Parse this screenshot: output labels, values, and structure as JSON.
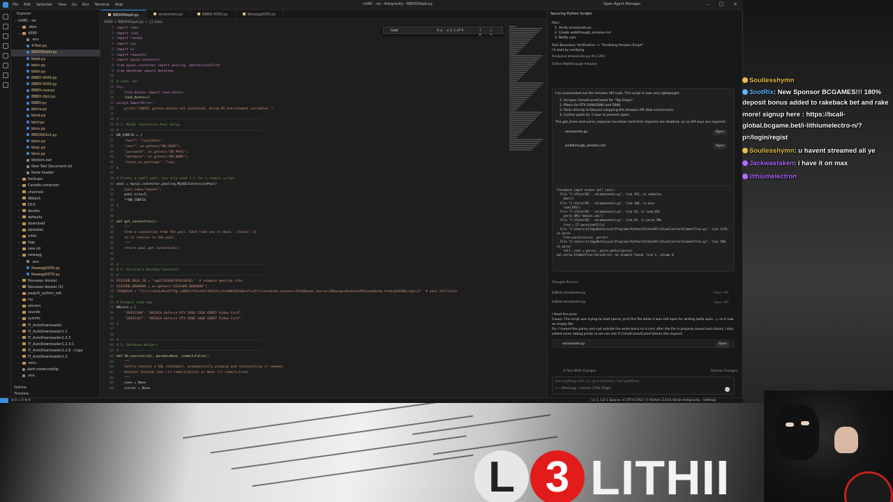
{
  "window": {
    "menu": [
      "File",
      "Edit",
      "Selection",
      "View",
      "Go",
      "Run",
      "Terminal",
      "Help"
    ],
    "title": "milRC - ne - Antigravity - BB5000opti.py",
    "agent_manager": "Open Agent Manager"
  },
  "explorer": {
    "header": "Explorer",
    "root": "milRC - ne",
    "items": [
      {
        "name": ".idea",
        "type": "folder",
        "indent": 1
      },
      {
        "name": "4090",
        "type": "folder",
        "indent": 1,
        "open": true
      },
      {
        "name": ".env",
        "type": "file",
        "indent": 2
      },
      {
        "name": "4-Test.py",
        "type": "py",
        "indent": 2
      },
      {
        "name": "BB5000opti.py",
        "type": "py",
        "indent": 2,
        "selected": true
      },
      {
        "name": "bbeb.py",
        "type": "py",
        "indent": 2
      },
      {
        "name": "bbbc.py",
        "type": "py",
        "indent": 2
      },
      {
        "name": "bbbo.py",
        "type": "py",
        "indent": 2
      },
      {
        "name": "BBBO-4000.py",
        "type": "py",
        "indent": 2
      },
      {
        "name": "BBBO-5000.py",
        "type": "py",
        "indent": 2
      },
      {
        "name": "BBBO-new.py",
        "type": "py",
        "indent": 2
      },
      {
        "name": "BBBO-Opti.py",
        "type": "py",
        "indent": 2
      },
      {
        "name": "BBBO.py",
        "type": "py",
        "indent": 2
      },
      {
        "name": "bbma.py",
        "type": "py",
        "indent": 2
      },
      {
        "name": "bbnb.py",
        "type": "py",
        "indent": 2
      },
      {
        "name": "bbnf.py",
        "type": "py",
        "indent": 2
      },
      {
        "name": "bbns.py",
        "type": "py",
        "indent": 2
      },
      {
        "name": "BBS0002v2.py",
        "type": "py",
        "indent": 2
      },
      {
        "name": "bbon.py",
        "type": "py",
        "indent": 2
      },
      {
        "name": "bbqc.py",
        "type": "py",
        "indent": 2
      },
      {
        "name": "bbsn.py",
        "type": "py",
        "indent": 2
      },
      {
        "name": "bbstore.bat",
        "type": "file",
        "indent": 2
      },
      {
        "name": "New Text Document.txt",
        "type": "file",
        "indent": 2
      },
      {
        "name": "Node header",
        "type": "file",
        "indent": 2
      },
      {
        "name": "backups",
        "type": "folder",
        "indent": 1
      },
      {
        "name": "Canada computer",
        "type": "folder",
        "indent": 1
      },
      {
        "name": "channels",
        "type": "folder",
        "indent": 1
      },
      {
        "name": "dbback",
        "type": "folder",
        "indent": 1
      },
      {
        "name": "DCX",
        "type": "folder",
        "indent": 1
      },
      {
        "name": "docdoc",
        "type": "folder",
        "indent": 1
      },
      {
        "name": "defaults",
        "type": "folder",
        "indent": 1
      },
      {
        "name": "download",
        "type": "folder",
        "indent": 1
      },
      {
        "name": "episodes",
        "type": "folder",
        "indent": 1
      },
      {
        "name": "infist",
        "type": "folder",
        "indent": 1
      },
      {
        "name": "logs",
        "type": "folder",
        "indent": 1
      },
      {
        "name": "new cd",
        "type": "folder",
        "indent": 1
      },
      {
        "name": "newegg",
        "type": "folder",
        "indent": 1,
        "open": true
      },
      {
        "name": ".env",
        "type": "file",
        "indent": 2
      },
      {
        "name": "Newegg5000.py",
        "type": "py",
        "indent": 2
      },
      {
        "name": "Newegg5070.py",
        "type": "py",
        "indent": 2
      },
      {
        "name": "Nouveau dossier",
        "type": "folder",
        "indent": 1
      },
      {
        "name": "Nouveau dossier (2)",
        "type": "folder",
        "indent": 1
      },
      {
        "name": "paapi5_python_sdk",
        "type": "folder",
        "indent": 1
      },
      {
        "name": "rss",
        "type": "folder",
        "indent": 1
      },
      {
        "name": "servers",
        "type": "folder",
        "indent": 1
      },
      {
        "name": "sounds",
        "type": "folder",
        "indent": 1
      },
      {
        "name": "sysinfo",
        "type": "folder",
        "indent": 1
      },
      {
        "name": "TI_AutoDownloader",
        "type": "folder",
        "indent": 1
      },
      {
        "name": "TI_AutoDownloader1.1",
        "type": "folder",
        "indent": 1
      },
      {
        "name": "TI_AutoDownloader1.2.3",
        "type": "folder",
        "indent": 1
      },
      {
        "name": "TI_AutoDownloader1.2.3-1",
        "type": "folder",
        "indent": 1
      },
      {
        "name": "TI_AutoDownloader1.2.6 - Copy",
        "type": "folder",
        "indent": 1
      },
      {
        "name": "TI_AutoDownloader1.3",
        "type": "folder",
        "indent": 1
      },
      {
        "name": "venv",
        "type": "folder",
        "indent": 1
      },
      {
        "name": "dark-mode-tooltip",
        "type": "file",
        "indent": 1
      },
      {
        "name": ".env",
        "type": "file",
        "indent": 1
      }
    ],
    "footer": [
      "Outline",
      "Timeline"
    ]
  },
  "editor": {
    "tabs": [
      {
        "label": "BB5000opti.py",
        "active": true
      },
      {
        "label": "amazonele.py",
        "active": false
      },
      {
        "label": "BBBO-5000.py",
        "active": false
      },
      {
        "label": "Newegg5000.py",
        "active": false
      }
    ],
    "breadcrumb": "4090 > BB5000opti.py > {} time",
    "find": {
      "query": "load",
      "options": "Aa ab .*",
      "count": "1 of 4",
      "nav": "↑ ↓ ≡ ×"
    },
    "lines": [
      {
        "n": "1",
        "t": "import time",
        "k": "kw"
      },
      {
        "n": "2",
        "t": "import json",
        "k": "kw"
      },
      {
        "n": "3",
        "t": "import random",
        "k": "kw"
      },
      {
        "n": "4",
        "t": "import sys",
        "k": "kw"
      },
      {
        "n": "5",
        "t": "import os",
        "k": "kw"
      },
      {
        "n": "6",
        "t": "import requests",
        "k": "kw"
      },
      {
        "n": "7",
        "t": "import mysql.connector",
        "k": "kw"
      },
      {
        "n": "8",
        "t": "from mysql.connector import pooling, OperationalError",
        "k": "kw"
      },
      {
        "n": "9",
        "t": "from datetime import datetime",
        "k": "kw"
      },
      {
        "n": "10",
        "t": "",
        "k": ""
      },
      {
        "n": "11",
        "t": "# Load .env",
        "k": "cm"
      },
      {
        "n": "12",
        "t": "try:",
        "k": "kw"
      },
      {
        "n": "13",
        "t": "    from dotenv import load_dotenv",
        "k": "kw"
      },
      {
        "n": "14",
        "t": "    load_dotenv()",
        "k": "fn"
      },
      {
        "n": "15",
        "t": "except ImportError:",
        "k": "kw"
      },
      {
        "n": "16",
        "t": "    print(\"[INFO] python-dotenv not installed. Using OS environment variables.\")",
        "k": "st"
      },
      {
        "n": "17",
        "t": "",
        "k": ""
      },
      {
        "n": "18",
        "t": "# ------------------------------------------------------------------------",
        "k": "cm"
      },
      {
        "n": "19",
        "t": "# 1. MySQL Connection Pool Setup",
        "k": "cm"
      },
      {
        "n": "20",
        "t": "# ------------------------------------------------------------------------",
        "k": "cm"
      },
      {
        "n": "21",
        "t": "DB_CONFIG = {",
        "k": ""
      },
      {
        "n": "22",
        "t": "    \"host\": \"localhost\",",
        "k": "st"
      },
      {
        "n": "23",
        "t": "    \"user\": os.getenv(\"DB_USER\"),",
        "k": "st"
      },
      {
        "n": "24",
        "t": "    \"password\": os.getenv(\"DB_PASS\"),",
        "k": "st"
      },
      {
        "n": "25",
        "t": "    \"database\": os.getenv(\"DB_NAME\"),",
        "k": "st"
      },
      {
        "n": "26",
        "t": "    \"raise_on_warnings\": True,",
        "k": "st"
      },
      {
        "n": "27",
        "t": "}",
        "k": ""
      },
      {
        "n": "28",
        "t": "",
        "k": ""
      },
      {
        "n": "29",
        "t": "# Create a small pool; you only need 1-5 for a simple script",
        "k": "cm"
      },
      {
        "n": "30",
        "t": "pool = mysql.connector.pooling.MySQLConnectionPool(",
        "k": ""
      },
      {
        "n": "31",
        "t": "    pool_name=\"mypool\",",
        "k": "st"
      },
      {
        "n": "32",
        "t": "    pool_size=5,",
        "k": ""
      },
      {
        "n": "33",
        "t": "    **DB_CONFIG",
        "k": ""
      },
      {
        "n": "34",
        "t": ")",
        "k": ""
      },
      {
        "n": "35",
        "t": "",
        "k": ""
      },
      {
        "n": "36",
        "t": "",
        "k": ""
      },
      {
        "n": "37",
        "t": "def get_connection():",
        "k": "fn"
      },
      {
        "n": "38",
        "t": "    \"\"\"",
        "k": "st"
      },
      {
        "n": "39",
        "t": "    Grab a connection from the pool. Each time you're done, .close() it",
        "k": "st"
      },
      {
        "n": "40",
        "t": "    so it returns to the pool.",
        "k": "st"
      },
      {
        "n": "41",
        "t": "    \"\"\"",
        "k": "st"
      },
      {
        "n": "42",
        "t": "    return pool.get_connection()",
        "k": "kw"
      },
      {
        "n": "43",
        "t": "",
        "k": ""
      },
      {
        "n": "44",
        "t": "",
        "k": ""
      },
      {
        "n": "45",
        "t": "# ------------------------------------------------------------------------",
        "k": "cm"
      },
      {
        "n": "46",
        "t": "# 2. Discord & BestBuy Constants",
        "k": "cm"
      },
      {
        "n": "47",
        "t": "# ------------------------------------------------------------------------",
        "k": "cm"
      },
      {
        "n": "48",
        "t": "DISCORD_ROLE_ID = \"<@&1745048295919636>\"  # example mention role",
        "k": "st"
      },
      {
        "n": "49",
        "t": "DISCORD_WEBHOOK = os.getenv(\"DISCORD_WEBHOOK\")",
        "k": "st"
      },
      {
        "n": "50",
        "t": "CASHBACK = \"?irclickid=Rxo5tT3g-xyN0Cxr5Xxxh5sY0k43jcc%3ANXA4Us0&ref=affiliate&utm_content=55284&utm_source=IR&acmp=Ebates%20Canada&utm_term=64446&irgwc=1\"  # your affiliate",
        "k": "st"
      },
      {
        "n": "51",
        "t": "",
        "k": ""
      },
      {
        "n": "52",
        "t": "# Product name map",
        "k": "cm"
      },
      {
        "n": "53",
        "t": "BBcard = {",
        "k": ""
      },
      {
        "n": "54",
        "t": "    \"18931348\": \"NVIDIA GeForce RTX 5090 32GB GDDR7 Video Card\",",
        "k": "st"
      },
      {
        "n": "55",
        "t": "    \"18931347\": \"NVIDIA GeForce RTX 5080 16GB GDDR7 Video Card\"",
        "k": "st"
      },
      {
        "n": "56",
        "t": "}",
        "k": ""
      },
      {
        "n": "57",
        "t": "",
        "k": ""
      },
      {
        "n": "58",
        "t": "",
        "k": ""
      },
      {
        "n": "59",
        "t": "# ------------------------------------------------------------------------",
        "k": "cm"
      },
      {
        "n": "60",
        "t": "# 3. Database Helpers",
        "k": "cm"
      },
      {
        "n": "61",
        "t": "# ------------------------------------------------------------------------",
        "k": "cm"
      },
      {
        "n": "62",
        "t": "def db_execute(sql, params=None, commit=False):",
        "k": "fn"
      },
      {
        "n": "63",
        "t": "    \"\"\"",
        "k": "st"
      },
      {
        "n": "64",
        "t": "    Safely execute a SQL statement, automatically pinging and reconnecting if needed.",
        "k": "st"
      },
      {
        "n": "65",
        "t": "    Returns fetched rows (if commit=False) or None (if commit=True).",
        "k": "st"
      },
      {
        "n": "66",
        "t": "    \"\"\"",
        "k": "st"
      },
      {
        "n": "67",
        "t": "    conn = None",
        "k": ""
      },
      {
        "n": "68",
        "t": "    cursor = None",
        "k": ""
      }
    ]
  },
  "statusbar": {
    "left": "⊗ 0 ⚠ 0   ⚙ 0",
    "right": "Ln 1, Col 1   Spaces: 4   UTF-8   CRLF   {} Python   3.10.6 64-bit   Antigravity - Settings"
  },
  "agent": {
    "title": "Securing Python Scripts",
    "plan_label": "Plan:",
    "plan_items": [
      "1.  Verify  amazonele.py .",
      "2.  Create  walkthrough_amazon.md .",
      "3.  Notify user."
    ],
    "task_boundary": "Task Boundary: Verification -> \"Finalizing Amazon Script\".",
    "start": "I'll start by verifying.",
    "analyzed": "Analyzed   amazonele.py #L1-265",
    "edited1": "Edited   Walkthrough Amazon",
    "summary": "I've commented out the Amazon API code. The script is now very lightweight:",
    "bullets": [
      "1.  Scrapes CamelCamelCamel for \"Top Drops\".",
      "2.  Filters for RTX 5090/5080 and 5080.",
      "3.  Posts directly to Discord (skipping the Amazon API data enrichment).",
      "4.  Caches posts for 1 hour to prevent spam."
    ],
    "note": "The get_items and parse_response functions (and their imports) are disabled, so no API keys are required.",
    "file1": "amazonele.py",
    "file2": "walkthrough_amazon.md",
    "open_label": "Open",
    "traceback": "Traceback (most recent call last):\n  File \"C:\\Py\\milRC - ne\\amazonele.py\", line 292, in <module>\n    main()\n  File \"C:\\Py\\milRC - ne\\amazonele.py\", line 286, in main\n    load_RSS()\n  File \"C:\\Py\\milRC - ne\\amazonele.py\", line 56, in load_RSS\n    parse_XML(\"amazon.xml\")\n  File \"C:\\Py\\milRC - ne\\amazonele.py\", line 65, in parse_XML\n    tree = ET.parse(xmlFile)\n  File \"C:\\Users\\L1\\AppData\\Local\\Programs\\Python\\Python39\\lib\\xml\\etree\\ElementTree.py\", line 1229, in parse\n    tree.parse(source, parser)\n  File \"C:\\Users\\L1\\AppData\\Local\\Programs\\Python\\Python39\\lib\\xml\\etree\\ElementTree.py\", line 580, in parse\n    self._root = parser._parse_whole(source)\nxml.etree.ElementTree.ParseError: no element found: line 1, column 0",
    "thought": "Thought Process",
    "edited2": "Edited   amazonele.py",
    "edited3": "Edited   amazonele.py",
    "open_diff": "Open diff",
    "fix_title": "I fixed the error.",
    "fix_cause": "Cause: The script was trying to read (parse_xml) the file while it was still open for writing (with open...), so it saw an empty file.",
    "fix_desc": "Fix: I moved the parse_xml call outside the write block so it runs after the file is properly saved and closed. I also added some debug prints so we can see if CamelCamelCamel blocks the request.",
    "file3": "amazonele.py",
    "changes": "0 Files With Changes",
    "review": "Review Changes",
    "input_placeholder": "Ask anything (Ctrl+L), @ to mention, / for workflows",
    "input_sub": "+  ⌁ Planning   ⌁ Gemini 3 Pro (High)"
  },
  "overlay": {
    "chat": [
      {
        "user": "Soullesshymn",
        "msg": "",
        "color": "#e6c248"
      },
      {
        "user": "3ootRix",
        "msg": ": New Sponsor BCGAMES!!! 180%",
        "color": "#5fb9ff"
      },
      {
        "user": "",
        "msg": "deposit bonus added to rakeback bet and rake",
        "color": ""
      },
      {
        "user": "",
        "msg": "more! signup here : https://bcall-",
        "color": ""
      },
      {
        "user": "",
        "msg": "global.bcgame.bet/i-lithiumelectro-n/?",
        "color": ""
      },
      {
        "user": "",
        "msg": "p=/login/regist",
        "color": ""
      },
      {
        "user": "Soullesshymn",
        "msg": ": u havent streamed all ye",
        "color": "#e6c248"
      },
      {
        "user": "Jackwastaken",
        "msg": ": i have it on max",
        "color": "#b06cff"
      },
      {
        "user": "lithiumelectron",
        "msg": "",
        "color": "#b06cff"
      }
    ],
    "logo_left": "L",
    "logo_num": "3",
    "logo_word": "LITHII"
  }
}
